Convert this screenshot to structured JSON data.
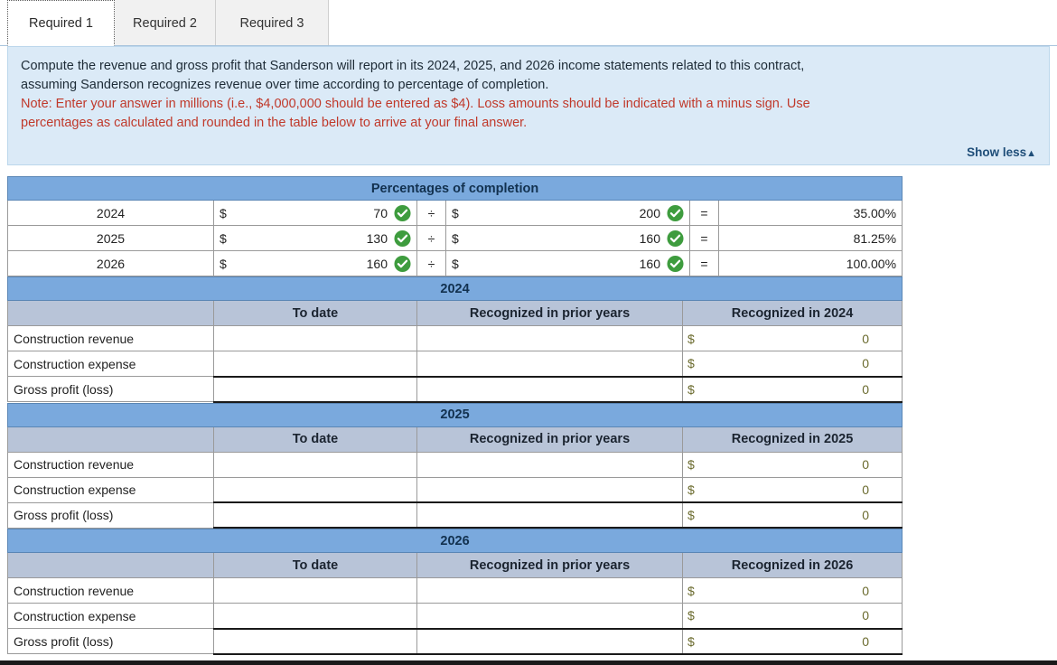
{
  "tabs": [
    {
      "label": "Required 1",
      "active": true
    },
    {
      "label": "Required 2",
      "active": false
    },
    {
      "label": "Required 3",
      "active": false
    }
  ],
  "instructions": {
    "line1": "Compute the revenue and gross profit that Sanderson will report in its 2024, 2025, and 2026 income statements related to this contract,",
    "line2": "assuming Sanderson recognizes revenue over time according to percentage of completion.",
    "note1": "Note: Enter your answer in millions (i.e., $4,000,000 should be entered as $4). Loss amounts should be indicated with a minus sign. Use",
    "note2": "percentages as calculated and rounded in the table below to arrive at your final answer.",
    "show_less_label": "Show less",
    "show_less_caret": "▲"
  },
  "percentages_table": {
    "title": "Percentages of completion",
    "currency_symbol": "$",
    "divide_symbol": "÷",
    "equals_symbol": "=",
    "check_icon": "green-check-icon",
    "rows": [
      {
        "year": "2024",
        "numerator": "70",
        "numerator_valid": true,
        "denominator": "200",
        "denominator_valid": true,
        "result": "35.00%"
      },
      {
        "year": "2025",
        "numerator": "130",
        "numerator_valid": true,
        "denominator": "160",
        "denominator_valid": true,
        "result": "81.25%"
      },
      {
        "year": "2026",
        "numerator": "160",
        "numerator_valid": true,
        "denominator": "160",
        "denominator_valid": true,
        "result": "100.00%"
      }
    ]
  },
  "year_sections": [
    {
      "year": "2024",
      "columns": [
        "",
        "To date",
        "Recognized in prior years",
        "Recognized in 2024"
      ],
      "rows": [
        {
          "label": "Construction revenue",
          "to_date": "",
          "prior_years": "",
          "currency_symbol": "$",
          "recognized": "0"
        },
        {
          "label": "Construction expense",
          "to_date": "",
          "prior_years": "",
          "currency_symbol": "$",
          "recognized": "0"
        },
        {
          "label": "Gross profit (loss)",
          "to_date": "",
          "prior_years": "",
          "currency_symbol": "$",
          "recognized": "0"
        }
      ]
    },
    {
      "year": "2025",
      "columns": [
        "",
        "To date",
        "Recognized in prior years",
        "Recognized in 2025"
      ],
      "rows": [
        {
          "label": "Construction revenue",
          "to_date": "",
          "prior_years": "",
          "currency_symbol": "$",
          "recognized": "0"
        },
        {
          "label": "Construction expense",
          "to_date": "",
          "prior_years": "",
          "currency_symbol": "$",
          "recognized": "0"
        },
        {
          "label": "Gross profit (loss)",
          "to_date": "",
          "prior_years": "",
          "currency_symbol": "$",
          "recognized": "0"
        }
      ]
    },
    {
      "year": "2026",
      "columns": [
        "",
        "To date",
        "Recognized in prior years",
        "Recognized in 2026"
      ],
      "rows": [
        {
          "label": "Construction revenue",
          "to_date": "",
          "prior_years": "",
          "currency_symbol": "$",
          "recognized": "0"
        },
        {
          "label": "Construction expense",
          "to_date": "",
          "prior_years": "",
          "currency_symbol": "$",
          "recognized": "0"
        },
        {
          "label": "Gross profit (loss)",
          "to_date": "",
          "prior_years": "",
          "currency_symbol": "$",
          "recognized": "0"
        }
      ]
    }
  ],
  "colors": {
    "header_blue": "#7aa9dd",
    "subheader_grey": "#b8c4d8",
    "instruction_panel": "#dbeaf7",
    "note_red": "#c0392b",
    "input_yellow": "#fbf7b5",
    "check_green": "#3e9c3e",
    "link_blue": "#1f4e79"
  }
}
